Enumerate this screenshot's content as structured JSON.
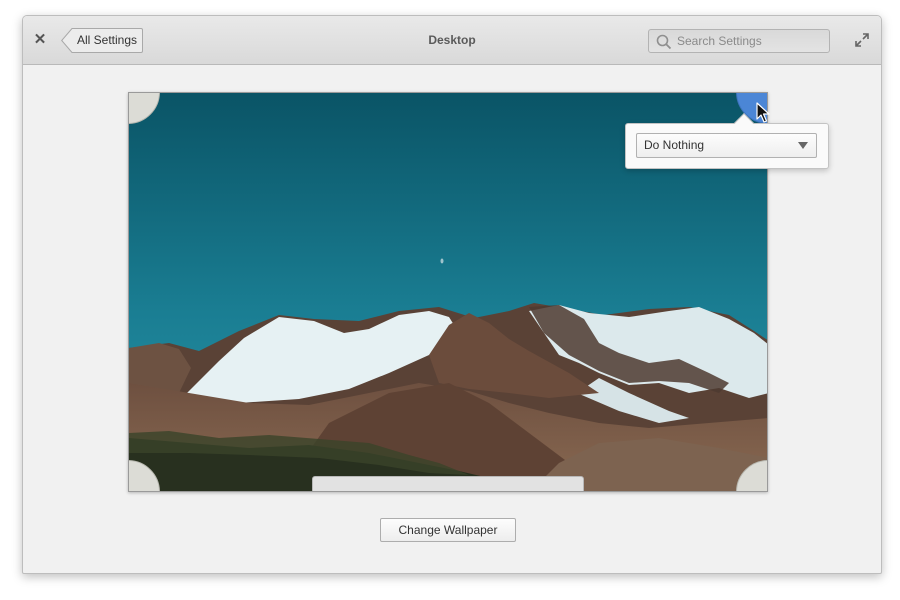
{
  "window": {
    "title": "Desktop",
    "back_label": "All Settings",
    "close_glyph": "✕",
    "maximize_icon": "maximize-icon"
  },
  "search": {
    "placeholder": "Search Settings",
    "value": ""
  },
  "hot_corner": {
    "selected_action": "Do Nothing",
    "active_corner": "top-right",
    "accent_color": "#4b86d6"
  },
  "wallpaper": {
    "subject": "snow-capped mountains under teal sky"
  },
  "actions": {
    "change_wallpaper_label": "Change Wallpaper"
  }
}
